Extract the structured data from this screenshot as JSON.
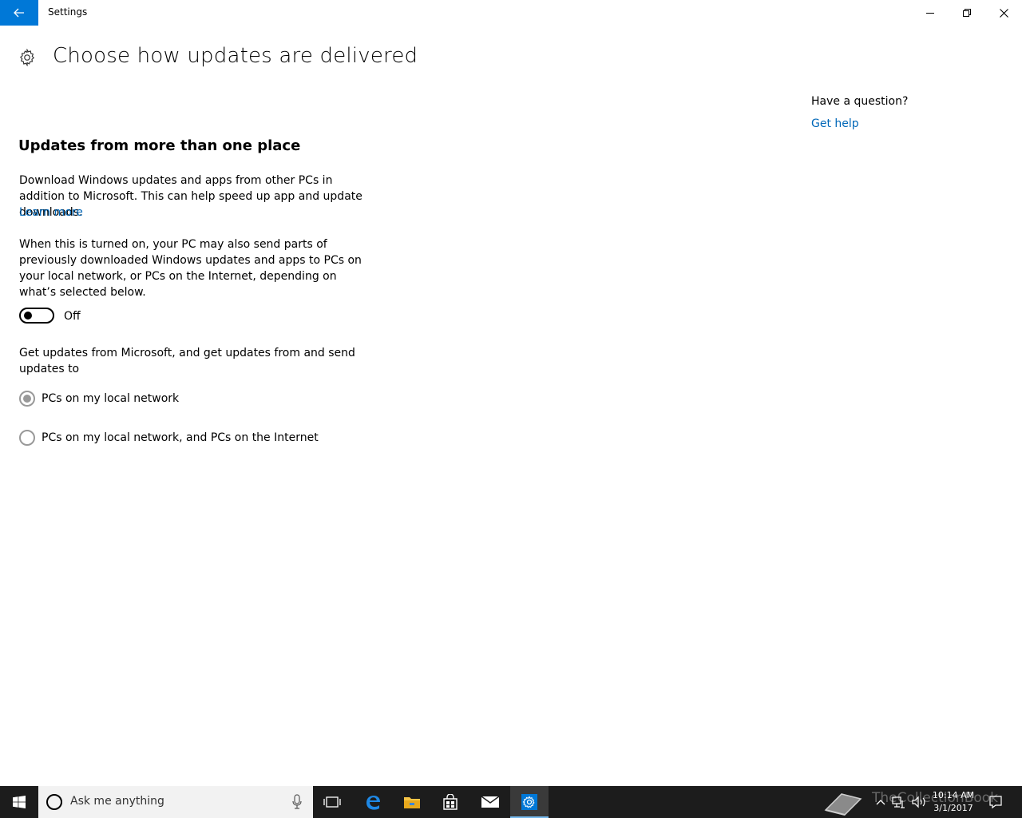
{
  "window": {
    "title": "Settings",
    "accent_color": "#0078d7",
    "back_icon": "back-arrow-icon",
    "controls": [
      "minimize-icon",
      "restore-icon",
      "close-icon"
    ]
  },
  "header": {
    "icon": "gear-icon",
    "title": "Choose how updates are delivered"
  },
  "main": {
    "section_title": "Updates from more than one place",
    "description": "Download Windows updates and apps from other PCs in addition to Microsoft. This can help speed up app and update downloads.",
    "learn_more": "Learn more",
    "toggle_description": "When this is turned on, your PC may also send parts of previously downloaded Windows updates and apps to PCs on your local network, or PCs on the Internet, depending on what’s selected below.",
    "toggle": {
      "state": "Off",
      "checked": false
    },
    "options_label": "Get updates from Microsoft, and get updates from and send updates to",
    "options": [
      {
        "label": "PCs on my local network",
        "selected": true
      },
      {
        "label": "PCs on my local network, and PCs on the Internet",
        "selected": false
      }
    ]
  },
  "aside": {
    "question": "Have a question?",
    "help_link": "Get help",
    "link_color": "#0067b8"
  },
  "taskbar": {
    "search_placeholder": "Ask me anything",
    "pinned": [
      "task-view-icon",
      "edge-icon",
      "file-explorer-icon",
      "store-icon",
      "mail-icon",
      "settings-icon"
    ],
    "active_app": "settings-icon",
    "watermark": "TheCollectionBook",
    "time": "10:14 AM",
    "date": "3/1/2017"
  }
}
